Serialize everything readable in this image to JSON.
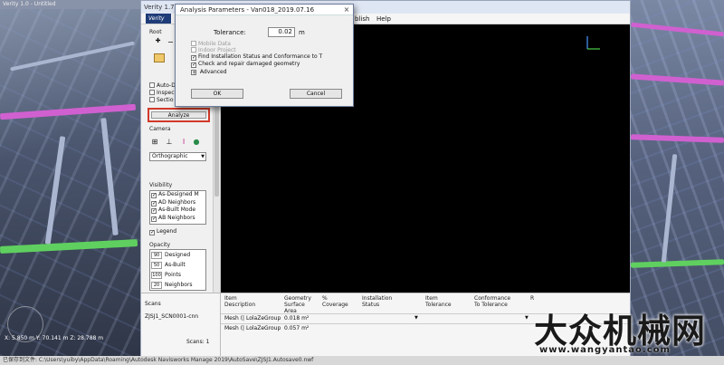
{
  "background_app": {
    "title": "Verity 1.0 - Untitled"
  },
  "window": {
    "title": "Verity 1.7",
    "menu": {
      "publish": "blish",
      "help": "Help"
    },
    "logo": "Verity",
    "accent_color": "#d23a2a"
  },
  "left_panel": {
    "root_label": "Root",
    "checkboxes": [
      "Auto-D",
      "Inspec",
      "Sectio"
    ],
    "analyze_label": "Analyze",
    "camera_label": "Camera",
    "camera_mode": "Orthographic",
    "visibility_label": "Visibility",
    "visibility_items": [
      "As-Designed M",
      "AD Neighbors",
      "As-Built Mode",
      "AB Neighbors"
    ],
    "legend_label": "Legend",
    "opacity_label": "Opacity",
    "opacity_items": [
      {
        "value": "90",
        "label": "Designed"
      },
      {
        "value": "50",
        "label": "As-Built"
      },
      {
        "value": "100",
        "label": "Points"
      },
      {
        "value": "20",
        "label": "Neighbors"
      }
    ]
  },
  "dialog": {
    "title": "Analysis Parameters - Van018_2019.07.16",
    "close_glyph": "×",
    "tolerance_label": "Tolerance:",
    "tolerance_value": "0.02",
    "tolerance_unit": "m",
    "options": [
      {
        "label": "Mobile Data",
        "checked": false,
        "disabled": true
      },
      {
        "label": "Indoor Project",
        "checked": false,
        "disabled": true
      },
      {
        "label": "Find Installation Status and Conformance to T",
        "checked": true,
        "disabled": false
      },
      {
        "label": "Check and repair damaged geometry",
        "checked": true,
        "disabled": false
      }
    ],
    "advanced_label": "Advanced",
    "advanced_toggle": "+",
    "ok_label": "OK",
    "cancel_label": "Cancel"
  },
  "bottom": {
    "scans_header": "Scans",
    "scan_item": "ZJSJ1_SCN0001-cnn",
    "scans_count": "Scans: 1",
    "columns": [
      "Item\nDescription",
      "Geometry\nSurface\nArea",
      "%\nCoverage",
      "Installation\nStatus",
      "Item\nTolerance",
      "Conformance\nTo Tolerance",
      "R"
    ],
    "rows": [
      {
        "description": "Mesh (| LolaZeGroup",
        "area": "0.018 m²"
      },
      {
        "description": "Mesh (| LolaZeGroup",
        "area": "0.057 m²"
      }
    ]
  },
  "coords": "X: 5.850 m  Y: 70.141 m  Z: 28.788 m",
  "status_text": "已保存到文件: C:\\Users\\yuiby\\AppData\\Roaming\\Autodesk Navisworks Manage 2019\\AutoSave\\ZJSJ1.Autosave0.nwf",
  "watermark": {
    "cn": "大众机械网",
    "url": "www.wangyantao.com"
  }
}
